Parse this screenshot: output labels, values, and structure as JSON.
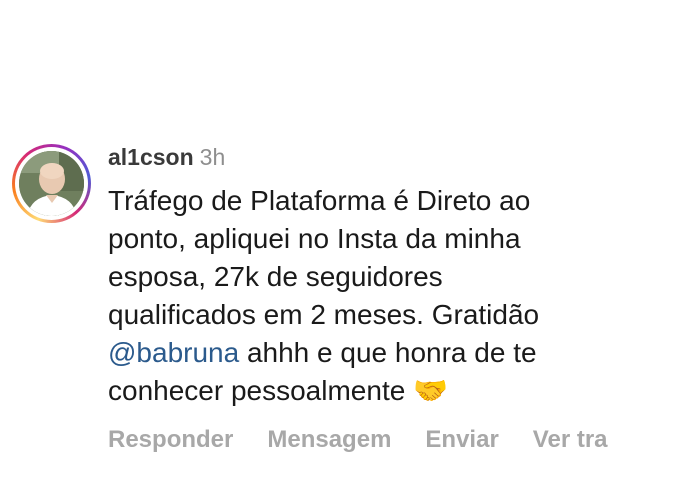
{
  "comment": {
    "username": "al1cson",
    "time": "3h",
    "text_lines": [
      "Tráfego de Plataforma é Direto ao",
      "ponto, apliquei no Insta da minha",
      "esposa, 27k de seguidores",
      "qualificados em 2 meses. Gratidão"
    ],
    "mention": "@babruna",
    "after_mention": " ahhh e que honra de te",
    "last_line": "conhecer pessoalmente ",
    "emoji": "🤝"
  },
  "actions": {
    "reply": "Responder",
    "message": "Mensagem",
    "send": "Enviar",
    "view_translation": "Ver tra"
  },
  "colors": {
    "mention": "#2b5a8c",
    "muted": "#8e8e8e",
    "action": "#a8a8a8"
  },
  "icons": {
    "avatar": "profile-photo",
    "story_ring": "story-ring-gradient"
  }
}
